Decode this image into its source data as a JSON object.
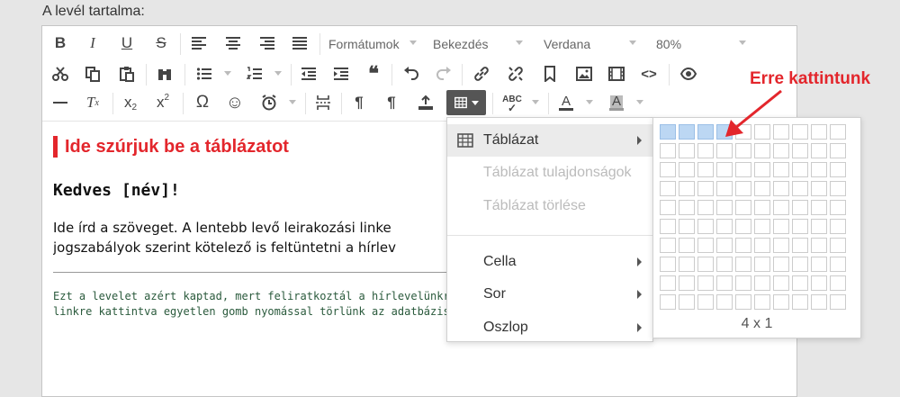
{
  "page_label": "A levél tartalma:",
  "toolbar": {
    "formats_label": "Formátumok",
    "block_label": "Bekezdés",
    "font_label": "Verdana",
    "size_label": "80%",
    "bold": "B",
    "italic": "I",
    "underline": "U",
    "strike": "S",
    "omega": "Ω",
    "pilcrow": "¶"
  },
  "content": {
    "note_title": "Ide szúrjuk be a táblázatot",
    "greeting": "Kedves [név]!",
    "body_line1": "Ide írd a szöveget. A lentebb levő leirakozási linke",
    "body_line2": "jogszabályok szerint kötelező is feltüntetni a hírlev",
    "footer_line1": "Ezt a levelet azért kaptad, mert feliratkoztál a hírlevelünkre. H",
    "footer_line2": "linkre kattintva egyetlen gomb nyomással törlünk az adatbázis"
  },
  "table_menu": {
    "items": [
      {
        "label": "Táblázat"
      },
      {
        "label": "Táblázat tulajdonságok"
      },
      {
        "label": "Táblázat törlése"
      },
      {
        "label": "Cella"
      },
      {
        "label": "Sor"
      },
      {
        "label": "Oszlop"
      }
    ]
  },
  "grid_picker": {
    "columns": 10,
    "rows": 10,
    "selected_cols": 4,
    "selected_rows": 1,
    "size_label": "4 x 1"
  },
  "annotation": {
    "text": "Erre kattintunk",
    "color": "#e3262c"
  }
}
